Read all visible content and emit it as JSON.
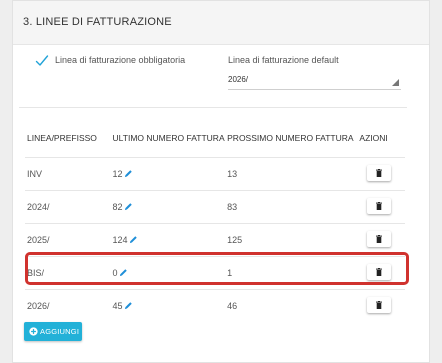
{
  "section": {
    "title": "3. LINEE DI FATTURAZIONE"
  },
  "form": {
    "mandatory_label": "Linea di fatturazione obbligatoria",
    "mandatory_checked": true,
    "default_label": "Linea di fatturazione default",
    "default_value": "2026/"
  },
  "table": {
    "headers": {
      "prefix": "LINEA/PREFISSO",
      "last_number": "ULTIMO NUMERO FATTURA",
      "next_number": "PROSSIMO NUMERO FATTURA",
      "actions": "AZIONI"
    },
    "rows": [
      {
        "prefix": "INV",
        "last": "12",
        "next": "13"
      },
      {
        "prefix": "2024/",
        "last": "82",
        "next": "83"
      },
      {
        "prefix": "2025/",
        "last": "124",
        "next": "125"
      },
      {
        "prefix": "BIS/",
        "last": "0",
        "next": "1"
      },
      {
        "prefix": "2026/",
        "last": "45",
        "next": "46"
      }
    ],
    "highlighted_row_index": 3
  },
  "add_button": {
    "label": "AGGIUNGI"
  },
  "colors": {
    "accent": "#22b1d8",
    "highlight": "#d0322e",
    "edit_icon": "#1f8fd8"
  },
  "icons": {
    "check": "check-icon",
    "edit": "pencil-icon",
    "delete": "trash-icon",
    "add": "plus-circle-icon"
  }
}
